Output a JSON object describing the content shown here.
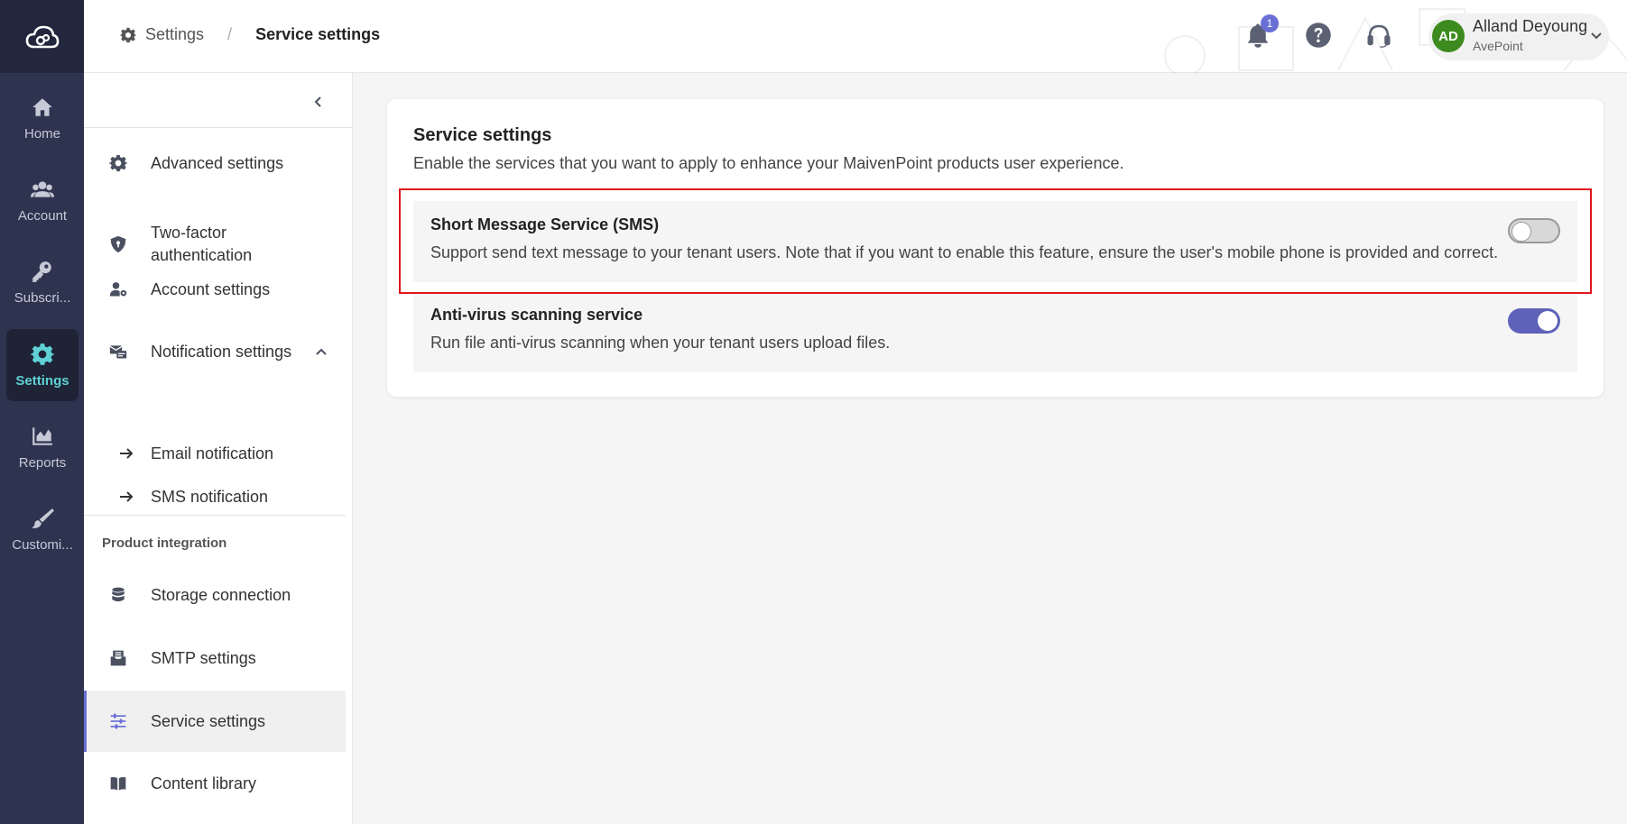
{
  "rail": {
    "items": [
      {
        "label": "Home",
        "icon": "home-icon"
      },
      {
        "label": "Account",
        "icon": "users-icon"
      },
      {
        "label": "Subscri...",
        "icon": "key-icon"
      },
      {
        "label": "Settings",
        "icon": "gear-icon",
        "active": true
      },
      {
        "label": "Reports",
        "icon": "chart-icon"
      },
      {
        "label": "Customi...",
        "icon": "brush-icon"
      }
    ]
  },
  "header": {
    "breadcrumb_root": "Settings",
    "breadcrumb_separator": "/",
    "breadcrumb_current": "Service settings",
    "notification_count": "1",
    "user_initials": "AD",
    "user_name": "Alland Deyoung",
    "user_org": "AvePoint"
  },
  "subnav": {
    "items": [
      {
        "label": "Advanced settings",
        "icon": "gear-icon"
      },
      {
        "label": "Two-factor",
        "label2": "authentication",
        "icon": "shield-icon"
      },
      {
        "label": "Account settings",
        "icon": "user-cog-icon"
      },
      {
        "label": "Notification settings",
        "icon": "notification-icon"
      },
      {
        "label": "Email notification"
      },
      {
        "label": "SMS notification"
      },
      {
        "label": "Storage connection",
        "icon": "database-icon"
      },
      {
        "label": "SMTP settings",
        "icon": "mail-tray-icon"
      },
      {
        "label": "Service settings",
        "icon": "sliders-icon",
        "active": true
      },
      {
        "label": "Content library",
        "icon": "book-icon"
      }
    ],
    "section_label": "Product integration"
  },
  "main": {
    "title": "Service settings",
    "description": "Enable the services that you want to apply to enhance your MaivenPoint products user experience.",
    "services": [
      {
        "title": "Short Message Service (SMS)",
        "description": "Support send text message to your tenant users. Note that if you want to enable this feature, ensure the user's mobile phone is provided and correct.",
        "enabled": false
      },
      {
        "title": "Anti-virus scanning service",
        "description": "Run file anti-virus scanning when your tenant users upload files.",
        "enabled": true
      }
    ]
  },
  "colors": {
    "rail_bg": "#2e3350",
    "accent": "#5f62b8",
    "active_rail": "#5fd1d4",
    "highlight": "#e0161b"
  }
}
